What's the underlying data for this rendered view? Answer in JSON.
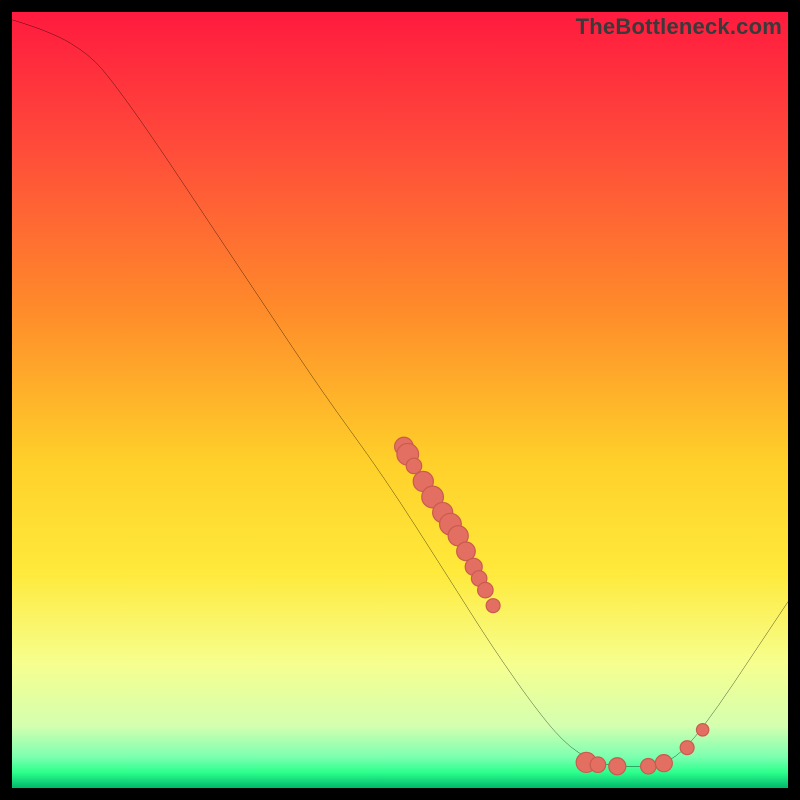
{
  "watermark": "TheBottleneck.com",
  "colors": {
    "curve": "#000000",
    "marker_fill": "#e26f61",
    "marker_stroke": "#c95a4d",
    "frame": "#000000",
    "gradient_top": "#ff1a3f",
    "gradient_mid_orange": "#ff8a2a",
    "gradient_mid_yellow": "#ffe93a",
    "gradient_light": "#f6ff8f",
    "gradient_green": "#2cff8c",
    "gradient_bottom": "#00b86b"
  },
  "chart_data": {
    "type": "line",
    "title": "",
    "xlabel": "",
    "ylabel": "",
    "xlim": [
      0,
      100
    ],
    "ylim": [
      0,
      100
    ],
    "curve": [
      {
        "x": 0.0,
        "y": 99.0
      },
      {
        "x": 5.0,
        "y": 97.5
      },
      {
        "x": 10.0,
        "y": 94.5
      },
      {
        "x": 13.0,
        "y": 91.0
      },
      {
        "x": 18.0,
        "y": 84.0
      },
      {
        "x": 25.0,
        "y": 73.5
      },
      {
        "x": 32.0,
        "y": 63.0
      },
      {
        "x": 40.0,
        "y": 51.0
      },
      {
        "x": 48.0,
        "y": 40.0
      },
      {
        "x": 56.0,
        "y": 27.5
      },
      {
        "x": 62.0,
        "y": 18.0
      },
      {
        "x": 68.0,
        "y": 9.5
      },
      {
        "x": 72.0,
        "y": 5.0
      },
      {
        "x": 76.0,
        "y": 3.0
      },
      {
        "x": 80.0,
        "y": 2.7
      },
      {
        "x": 84.0,
        "y": 3.0
      },
      {
        "x": 87.0,
        "y": 5.2
      },
      {
        "x": 91.0,
        "y": 10.5
      },
      {
        "x": 95.0,
        "y": 16.5
      },
      {
        "x": 100.0,
        "y": 24.0
      }
    ],
    "markers": [
      {
        "x": 50.5,
        "y": 44.0,
        "r": 1.2
      },
      {
        "x": 51.0,
        "y": 43.0,
        "r": 1.4
      },
      {
        "x": 51.8,
        "y": 41.5,
        "r": 1.0
      },
      {
        "x": 53.0,
        "y": 39.5,
        "r": 1.3
      },
      {
        "x": 54.2,
        "y": 37.5,
        "r": 1.4
      },
      {
        "x": 55.5,
        "y": 35.5,
        "r": 1.3
      },
      {
        "x": 56.5,
        "y": 34.0,
        "r": 1.4
      },
      {
        "x": 57.5,
        "y": 32.5,
        "r": 1.3
      },
      {
        "x": 58.5,
        "y": 30.5,
        "r": 1.2
      },
      {
        "x": 59.5,
        "y": 28.5,
        "r": 1.1
      },
      {
        "x": 60.2,
        "y": 27.0,
        "r": 1.0
      },
      {
        "x": 61.0,
        "y": 25.5,
        "r": 1.0
      },
      {
        "x": 62.0,
        "y": 23.5,
        "r": 0.9
      },
      {
        "x": 74.0,
        "y": 3.3,
        "r": 1.3
      },
      {
        "x": 75.5,
        "y": 3.0,
        "r": 1.0
      },
      {
        "x": 78.0,
        "y": 2.8,
        "r": 1.1
      },
      {
        "x": 82.0,
        "y": 2.8,
        "r": 1.0
      },
      {
        "x": 84.0,
        "y": 3.2,
        "r": 1.1
      },
      {
        "x": 87.0,
        "y": 5.2,
        "r": 0.9
      },
      {
        "x": 89.0,
        "y": 7.5,
        "r": 0.8
      }
    ]
  }
}
